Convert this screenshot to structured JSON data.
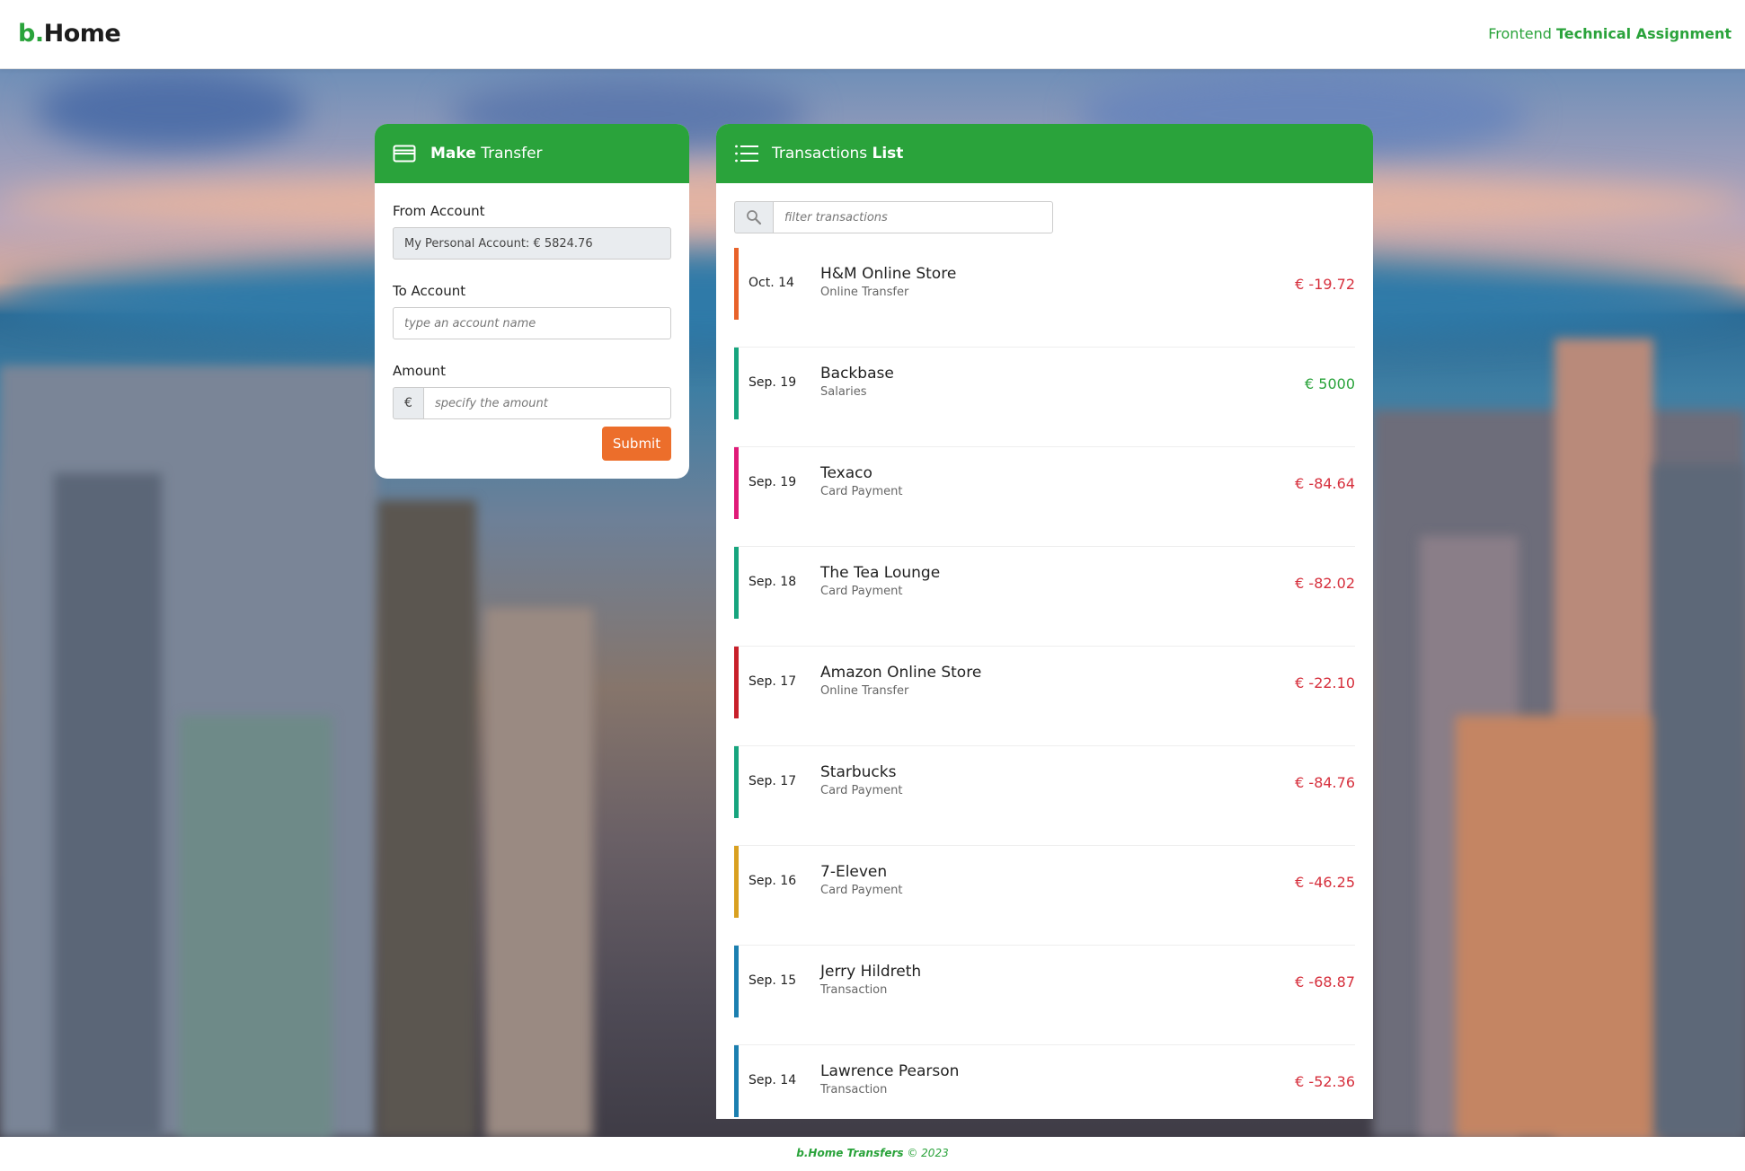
{
  "header": {
    "logo_b": "b.",
    "logo_home": "Home",
    "tagline_prefix": "Frontend",
    "tagline_bold": "Technical Assignment"
  },
  "transfer": {
    "title_bold": "Make",
    "title_rest": "Transfer",
    "from_label": "From Account",
    "from_value": "My Personal Account: € 5824.76",
    "to_label": "To Account",
    "to_placeholder": "type an account name",
    "amount_label": "Amount",
    "currency": "€",
    "amount_placeholder": "specify the amount",
    "submit_label": "Submit"
  },
  "transactions": {
    "title_rest": "Transactions",
    "title_bold": "List",
    "filter_placeholder": "filter transactions",
    "rows": [
      {
        "date": "Oct. 14",
        "merchant": "H&M Online Store",
        "type": "Online Transfer",
        "amount": "€ -19.72",
        "sign": "neg",
        "color": "#e8622a"
      },
      {
        "date": "Sep. 19",
        "merchant": "Backbase",
        "type": "Salaries",
        "amount": "€ 5000",
        "sign": "pos",
        "color": "#17a57e"
      },
      {
        "date": "Sep. 19",
        "merchant": "Texaco",
        "type": "Card Payment",
        "amount": "€ -84.64",
        "sign": "neg",
        "color": "#e01a78"
      },
      {
        "date": "Sep. 18",
        "merchant": "The Tea Lounge",
        "type": "Card Payment",
        "amount": "€ -82.02",
        "sign": "neg",
        "color": "#17a57e"
      },
      {
        "date": "Sep. 17",
        "merchant": "Amazon Online Store",
        "type": "Online Transfer",
        "amount": "€ -22.10",
        "sign": "neg",
        "color": "#c81f2a"
      },
      {
        "date": "Sep. 17",
        "merchant": "Starbucks",
        "type": "Card Payment",
        "amount": "€ -84.76",
        "sign": "neg",
        "color": "#17a57e"
      },
      {
        "date": "Sep. 16",
        "merchant": "7-Eleven",
        "type": "Card Payment",
        "amount": "€ -46.25",
        "sign": "neg",
        "color": "#d9a020"
      },
      {
        "date": "Sep. 15",
        "merchant": "Jerry Hildreth",
        "type": "Transaction",
        "amount": "€ -68.87",
        "sign": "neg",
        "color": "#1b7fb0"
      },
      {
        "date": "Sep. 14",
        "merchant": "Lawrence Pearson",
        "type": "Transaction",
        "amount": "€ -52.36",
        "sign": "neg",
        "color": "#1b7fb0"
      }
    ]
  },
  "footer": {
    "brand": "b.Home Transfers",
    "copyright": "© 2023"
  },
  "colors": {
    "brand_green": "#2aa33b",
    "submit_orange": "#ec6e2b",
    "negative_red": "#d62f3c"
  },
  "icons": {
    "transfer_header": "credit-card-icon",
    "transactions_header": "list-icon",
    "search": "search-icon"
  }
}
